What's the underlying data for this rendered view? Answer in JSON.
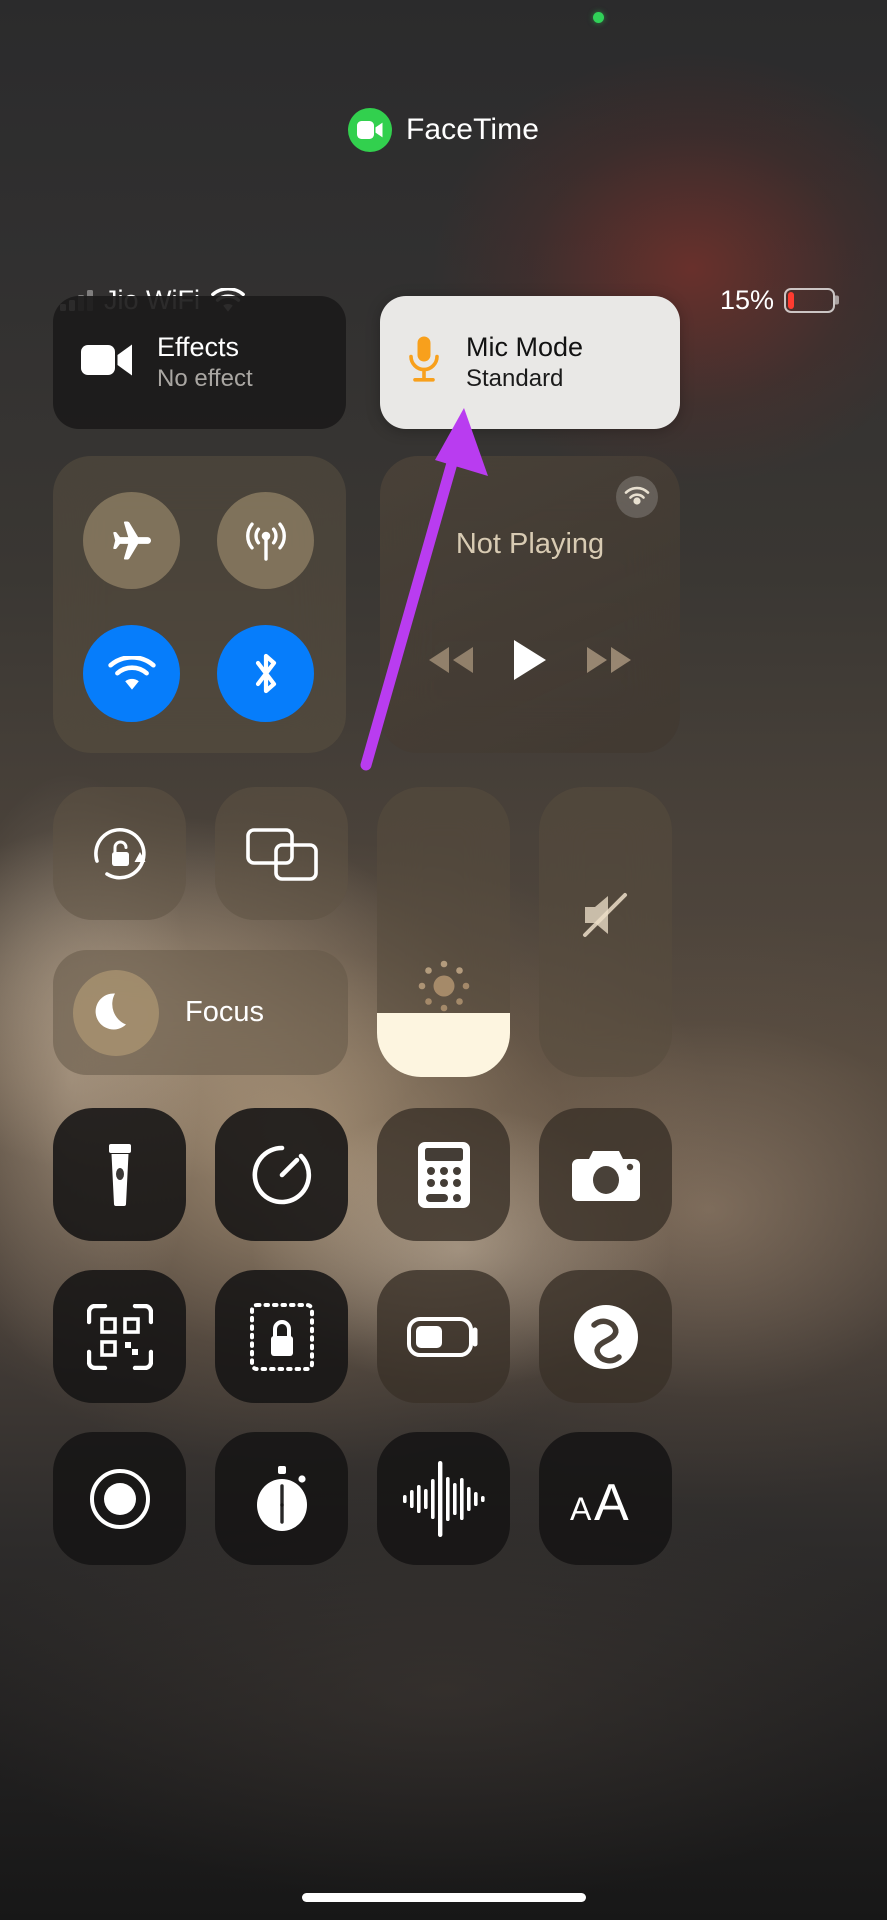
{
  "app_banner": {
    "label": "FaceTime",
    "icon": "video-camera-icon",
    "icon_color": "#32d04e"
  },
  "recording_indicator": {
    "name": "recording-dot",
    "color": "#30d158"
  },
  "status_bar": {
    "carrier": "Jio WiFi",
    "signal_bars_active": 2,
    "signal_bars_total": 4,
    "wifi_icon": "wifi-icon",
    "battery_percent_label": "15%",
    "battery_level": 15,
    "battery_color": "#ff3b30"
  },
  "effects_card": {
    "title": "Effects",
    "subtitle": "No effect",
    "icon": "video-camera-icon"
  },
  "mic_mode_card": {
    "title": "Mic Mode",
    "subtitle": "Standard",
    "icon": "microphone-icon",
    "icon_color": "#f8a01c",
    "background": "#e9e8e6"
  },
  "connectivity": {
    "buttons": [
      {
        "name": "airplane-mode-toggle",
        "icon": "airplane-icon",
        "state": "off"
      },
      {
        "name": "cellular-data-toggle",
        "icon": "cellular-antenna-icon",
        "state": "off"
      },
      {
        "name": "wifi-toggle",
        "icon": "wifi-icon",
        "state": "on"
      },
      {
        "name": "bluetooth-toggle",
        "icon": "bluetooth-icon",
        "state": "on"
      }
    ],
    "active_color": "#067dfb"
  },
  "media_player": {
    "status": "Not Playing",
    "airplay_icon": "airplay-audio-icon",
    "controls": [
      {
        "name": "rewind-button",
        "icon": "rewind-icon"
      },
      {
        "name": "play-button",
        "icon": "play-icon"
      },
      {
        "name": "fast-forward-button",
        "icon": "fast-forward-icon"
      }
    ]
  },
  "toggles": {
    "rotation_lock": {
      "name": "rotation-lock-toggle",
      "icon": "rotation-lock-open-icon",
      "state": "off"
    },
    "screen_mirroring": {
      "name": "screen-mirroring-button",
      "icon": "screen-mirroring-icon"
    }
  },
  "focus": {
    "label": "Focus",
    "icon": "moon-icon"
  },
  "sliders": {
    "brightness": {
      "name": "brightness-slider",
      "icon": "brightness-sun-icon",
      "value": 22
    },
    "volume": {
      "name": "volume-slider",
      "icon": "speaker-mute-icon",
      "value": 0,
      "muted": true
    }
  },
  "app_grid": [
    {
      "name": "flashlight-button",
      "icon": "flashlight-icon",
      "tone": "dark"
    },
    {
      "name": "timer-button",
      "icon": "timer-icon",
      "tone": "dark"
    },
    {
      "name": "calculator-button",
      "icon": "calculator-icon",
      "tone": "warm"
    },
    {
      "name": "camera-button",
      "icon": "camera-icon",
      "tone": "warm"
    },
    {
      "name": "qr-code-scanner-button",
      "icon": "qr-code-icon",
      "tone": "dark"
    },
    {
      "name": "guided-access-button",
      "icon": "lock-dotted-icon",
      "tone": "dark"
    },
    {
      "name": "low-power-mode-button",
      "icon": "battery-low-power-icon",
      "tone": "warm"
    },
    {
      "name": "shazam-button",
      "icon": "shazam-icon",
      "tone": "warm"
    },
    {
      "name": "screen-recording-button",
      "icon": "record-circle-icon",
      "tone": "dark"
    },
    {
      "name": "stopwatch-button",
      "icon": "stopwatch-icon",
      "tone": "dark"
    },
    {
      "name": "voice-memos-button",
      "icon": "audio-waveform-icon",
      "tone": "dark"
    },
    {
      "name": "text-size-button",
      "icon": "text-size-icon",
      "tone": "dark"
    }
  ],
  "annotation": {
    "name": "arrow-annotation",
    "color": "#b93cf0",
    "points_to": "mic-mode-card"
  },
  "home_indicator": {
    "name": "home-indicator"
  }
}
